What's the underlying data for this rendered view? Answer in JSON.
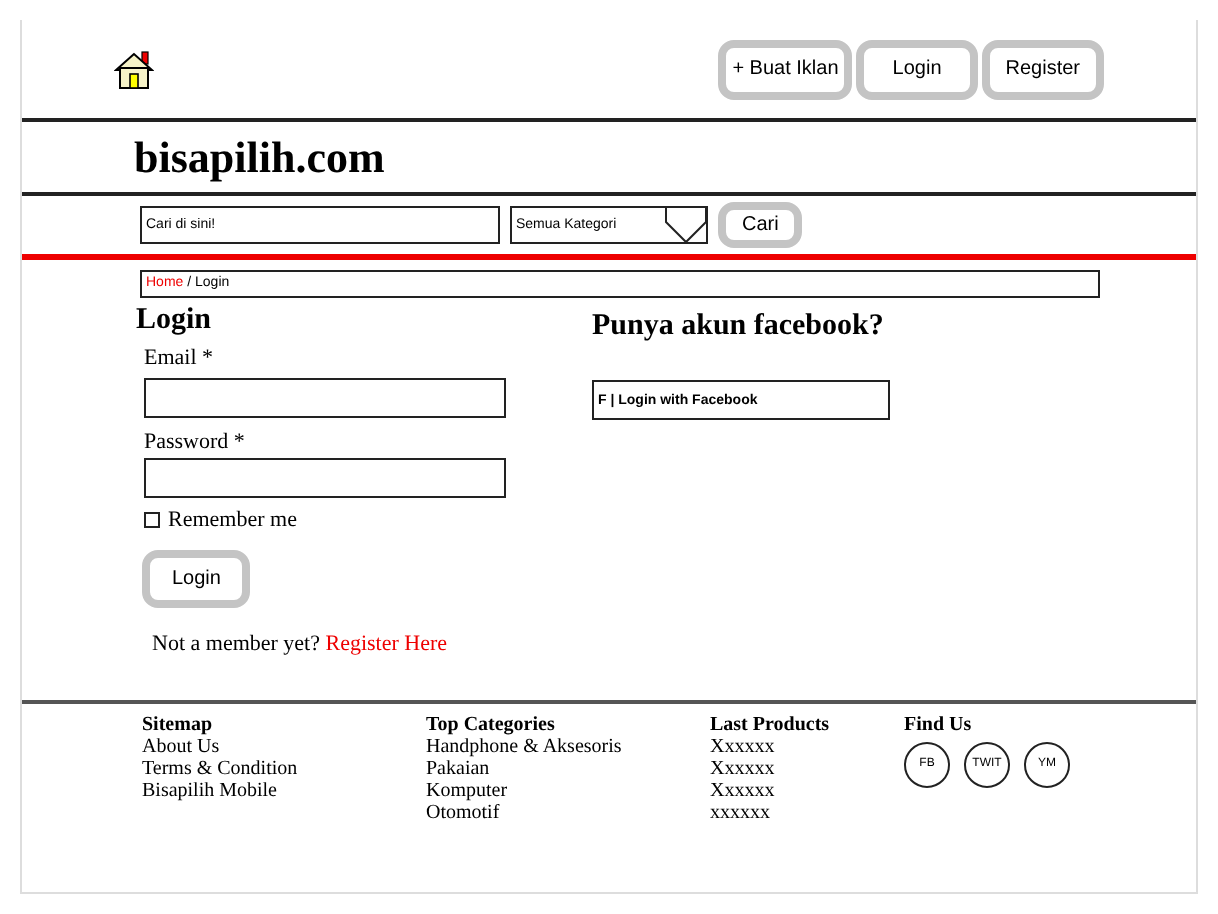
{
  "header": {
    "buttons": [
      "+ Buat Iklan",
      "Login",
      "Register"
    ]
  },
  "site_title": "bisapilih.com",
  "search": {
    "placeholder": "Cari di sini!",
    "category": "Semua Kategori",
    "button": "Cari"
  },
  "breadcrumb": {
    "items": [
      "Home",
      "Login"
    ],
    "separator": "/"
  },
  "login": {
    "title": "Login",
    "fields": [
      {
        "label": "Email *"
      },
      {
        "label": "Password *"
      }
    ],
    "remember": {
      "label": "Remember me",
      "checked": false
    },
    "button": "Login",
    "signup": {
      "text": "Not a member yet?",
      "link": "Register Here"
    }
  },
  "facebook": {
    "title": "Punya akun facebook?",
    "button": "F | Login with Facebook"
  },
  "footer": {
    "columns": [
      {
        "title": "Sitemap",
        "items": [
          "About Us",
          "Terms & Condition",
          "Bisapilih Mobile"
        ]
      },
      {
        "title": "Top Categories",
        "items": [
          "Handphone & Aksesoris",
          "Pakaian",
          "Komputer",
          "Otomotif"
        ]
      },
      {
        "title": "Last Products",
        "items": [
          "Xxxxxx",
          "Xxxxxx",
          "Xxxxxx",
          "xxxxxx"
        ]
      }
    ],
    "find_us": {
      "title": "Find Us",
      "links": [
        "FB",
        "TWIT",
        "YM"
      ]
    }
  }
}
